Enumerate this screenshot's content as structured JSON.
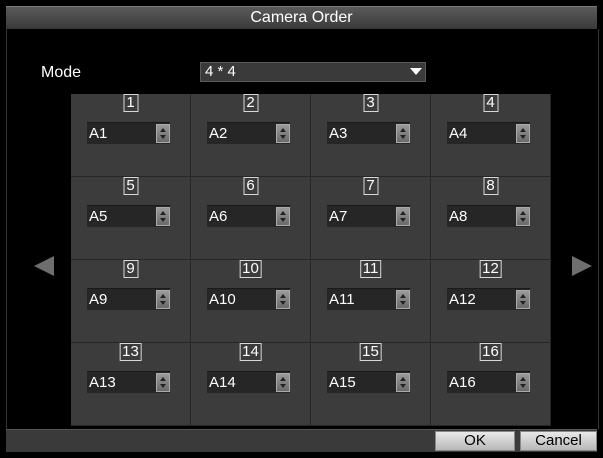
{
  "window": {
    "title": "Camera Order"
  },
  "mode": {
    "label": "Mode",
    "value": "4 * 4"
  },
  "grid": {
    "cells": [
      {
        "num": "1",
        "camera": "A1"
      },
      {
        "num": "2",
        "camera": "A2"
      },
      {
        "num": "3",
        "camera": "A3"
      },
      {
        "num": "4",
        "camera": "A4"
      },
      {
        "num": "5",
        "camera": "A5"
      },
      {
        "num": "6",
        "camera": "A6"
      },
      {
        "num": "7",
        "camera": "A7"
      },
      {
        "num": "8",
        "camera": "A8"
      },
      {
        "num": "9",
        "camera": "A9"
      },
      {
        "num": "10",
        "camera": "A10"
      },
      {
        "num": "11",
        "camera": "A11"
      },
      {
        "num": "12",
        "camera": "A12"
      },
      {
        "num": "13",
        "camera": "A13"
      },
      {
        "num": "14",
        "camera": "A14"
      },
      {
        "num": "15",
        "camera": "A15"
      },
      {
        "num": "16",
        "camera": "A16"
      }
    ]
  },
  "buttons": {
    "ok": "OK",
    "cancel": "Cancel"
  },
  "icons": {
    "prev": "left-arrow-icon",
    "next": "right-arrow-icon",
    "dropdown": "chevron-down-icon",
    "spinner": "spinner-icon"
  },
  "colors": {
    "background": "#000000",
    "grid_bg": "#3c3c3c",
    "title_bar": "#4a4a4a"
  }
}
